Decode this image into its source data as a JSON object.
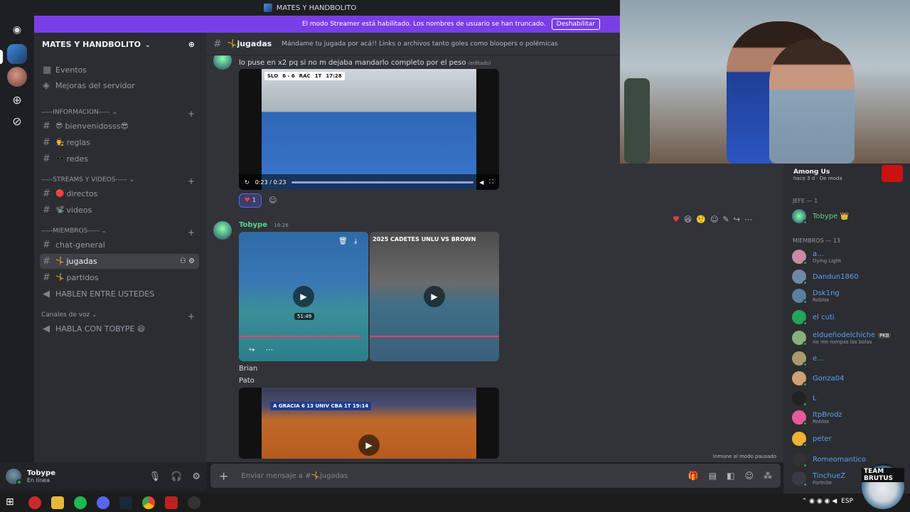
{
  "window": {
    "title": "MATES Y HANDBOLITO"
  },
  "banner": {
    "text": "El modo Streamer está habilitado. Los nombres de usuario se han truncado.",
    "button": "Deshabilitar",
    "color": "#7a3ee6"
  },
  "server": {
    "name": "MATES Y HANDBOLITO"
  },
  "sidebar": {
    "top_items": [
      "Eventos",
      "Mejoras del servidor"
    ],
    "categories": [
      {
        "label": "-----INFORMACION-----",
        "channels": [
          {
            "emoji": "😎",
            "name": "bienvenidosss",
            "suffix": "😎"
          },
          {
            "emoji": "👨‍⚖️",
            "name": "reglas",
            "suffix": ""
          },
          {
            "emoji": "🕶️",
            "name": "redes",
            "suffix": ""
          }
        ]
      },
      {
        "label": "-----STREAMS Y VIDEOS-----",
        "channels": [
          {
            "emoji": "🔴",
            "name": "directos",
            "suffix": ""
          },
          {
            "emoji": "📽️",
            "name": "videos",
            "suffix": ""
          }
        ]
      },
      {
        "label": "-----MIEMBROS-----",
        "channels": [
          {
            "emoji": "",
            "name": "chat-general",
            "suffix": ""
          },
          {
            "emoji": "🤸",
            "name": "jugadas",
            "suffix": "",
            "selected": true
          },
          {
            "emoji": "🤸",
            "name": "partidos",
            "suffix": ""
          },
          {
            "emoji": "",
            "name": "HABLEN ENTRE USTEDES",
            "suffix": "",
            "voice": true
          }
        ]
      }
    ],
    "voice_category": "Canales de voz",
    "voice_channel": "HABLA CON TOBYPE 😄"
  },
  "user": {
    "name": "Tobype",
    "status": "En línea"
  },
  "channel": {
    "name": "jugadas",
    "emoji": "🤸",
    "topic": "Mándame tu jugada por acá!! Links o archivos tanto goles como bloopers o polémicas"
  },
  "messages": {
    "m1_text": "lo puse en x2 pq si no m dejaba mandarlo completo por el peso",
    "m1_edited": "(editado)",
    "video1": {
      "time": "0:23 / 0:23",
      "score": [
        "SLO",
        "6 - 6",
        "RAC",
        "1T",
        "17:28"
      ]
    },
    "reaction": {
      "emoji": "♥",
      "count": "1"
    },
    "m2_author": "Tobype",
    "m2_time": "16:26",
    "video2": {
      "duration": "51:49"
    },
    "video3": {
      "title": "2025 CADETES UNLU VS BROWN"
    },
    "m2_line1": "Brian",
    "m2_line2": "Pato",
    "video4": {
      "score": "A GRACIA 6 13 UNIV CBA 1T 19:14"
    },
    "immune": "Inmune al modo pausado"
  },
  "composer": {
    "placeholder": "Enviar mensaje a #🤸jugadas"
  },
  "members": {
    "activity": {
      "title": "Among Us",
      "sub1": "hace 3 d",
      "sub2": "De moda"
    },
    "jefe_header": "JEFE — 1",
    "jefe": [
      {
        "name": "Tobype 👑",
        "sub": ""
      }
    ],
    "miembros_header": "MIEMBROS — 13",
    "list": [
      {
        "name": "a...",
        "sub": "Dying Light"
      },
      {
        "name": "Dandun1860",
        "sub": ""
      },
      {
        "name": "Dsk1ng",
        "sub": "Roblox"
      },
      {
        "name": "el cuti",
        "sub": ""
      },
      {
        "name": "eldueñodelchiche",
        "sub": "no me rompas las bolas",
        "tag": "PKB"
      },
      {
        "name": "e...",
        "sub": ""
      },
      {
        "name": "Gonza04",
        "sub": ""
      },
      {
        "name": "L",
        "sub": ""
      },
      {
        "name": "ItpBrodz",
        "sub": "Roblox"
      },
      {
        "name": "peter",
        "sub": ""
      },
      {
        "name": "Romeomantico",
        "sub": ""
      },
      {
        "name": "TinchueZ",
        "sub": "Fortnite"
      }
    ]
  },
  "taskbar": {
    "lang": "ESP"
  },
  "logo": {
    "text": "TEAM BRUTUS"
  }
}
